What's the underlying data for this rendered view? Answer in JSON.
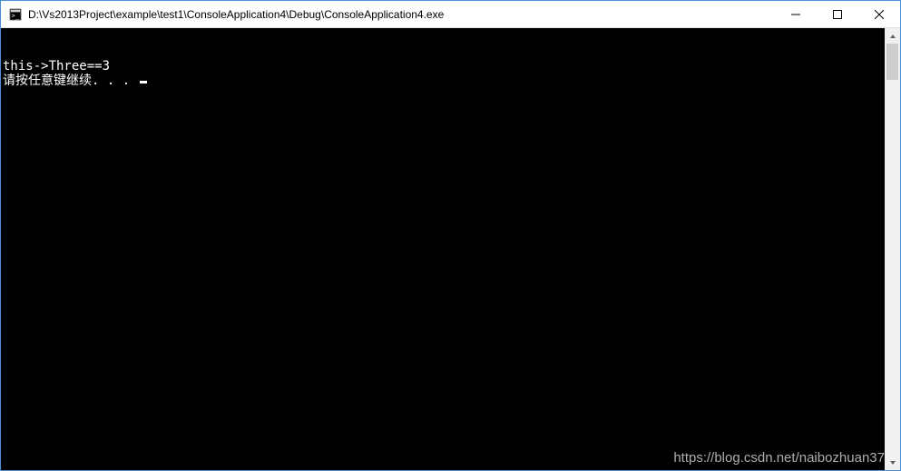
{
  "window": {
    "title": "D:\\Vs2013Project\\example\\test1\\ConsoleApplication4\\Debug\\ConsoleApplication4.exe",
    "icon_name": "console-app-icon"
  },
  "controls": {
    "minimize": "minimize",
    "maximize": "maximize",
    "close": "close"
  },
  "console": {
    "line1": "this->Three==3",
    "line2": "请按任意键继续. . . "
  },
  "scrollbar": {
    "up": "scroll-up",
    "down": "scroll-down"
  },
  "watermark": "https://blog.csdn.net/naibozhuan37"
}
